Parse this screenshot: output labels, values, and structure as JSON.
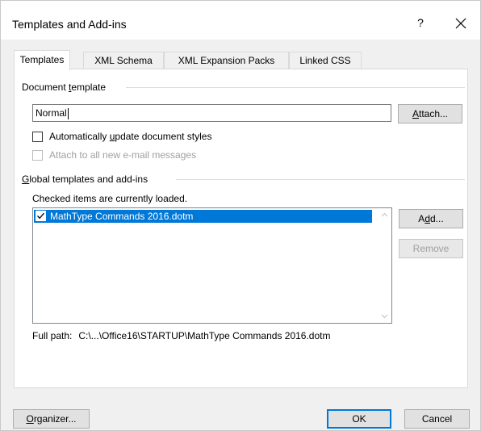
{
  "window": {
    "title": "Templates and Add-ins",
    "help_label": "?",
    "close_label": "✕"
  },
  "tabs": [
    {
      "label": "Templates",
      "active": true
    },
    {
      "label": "XML Schema",
      "active": false
    },
    {
      "label": "XML Expansion Packs",
      "active": false
    },
    {
      "label": "Linked CSS",
      "active": false
    }
  ],
  "document_template": {
    "group_label_pre": "Document ",
    "group_label_accel": "t",
    "group_label_post": "emplate",
    "value": "Normal",
    "attach_pre": "",
    "attach_accel": "A",
    "attach_post": "ttach...",
    "auto_update_pre": "Automatically ",
    "auto_update_accel": "u",
    "auto_update_post": "pdate document styles",
    "auto_update_checked": false,
    "attach_email": "Attach to all new e-mail messages",
    "attach_email_checked": false,
    "attach_email_enabled": false
  },
  "global_templates": {
    "group_label_pre": "",
    "group_label_accel": "G",
    "group_label_post": "lobal templates and add-ins",
    "hint": "Checked items are currently loaded.",
    "items": [
      {
        "label": "MathType Commands 2016.dotm",
        "checked": true,
        "selected": true
      }
    ],
    "add_pre": "A",
    "add_accel": "d",
    "add_post": "d...",
    "remove": "Remove",
    "full_path_label": "Full path:",
    "full_path_value": "C:\\...\\Office16\\STARTUP\\MathType Commands 2016.dotm"
  },
  "footer": {
    "organizer_pre": "",
    "organizer_accel": "O",
    "organizer_post": "rganizer...",
    "ok": "OK",
    "cancel": "Cancel"
  },
  "colors": {
    "accent": "#0078d7",
    "dialog_bg": "#f0f0f0",
    "panel_bg": "#ffffff",
    "disabled_text": "#a0a0a0"
  }
}
